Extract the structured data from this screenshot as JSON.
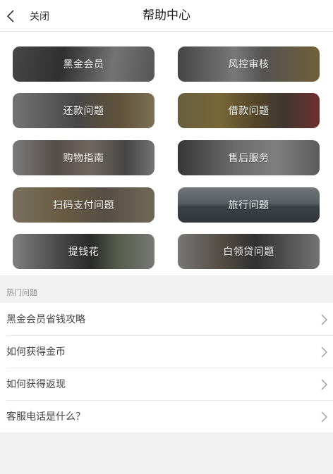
{
  "header": {
    "back_label": "关闭",
    "title": "帮助中心"
  },
  "categories": [
    {
      "label": "黑金会员"
    },
    {
      "label": "风控审核"
    },
    {
      "label": "还款问题"
    },
    {
      "label": "借款问题"
    },
    {
      "label": "购物指南"
    },
    {
      "label": "售后服务"
    },
    {
      "label": "扫码支付问题"
    },
    {
      "label": "旅行问题"
    },
    {
      "label": "提钱花"
    },
    {
      "label": "白领贷问题"
    }
  ],
  "hot": {
    "heading": "热门问题",
    "items": [
      {
        "label": "黑金会员省钱攻略"
      },
      {
        "label": "如何获得金币"
      },
      {
        "label": "如何获得返现"
      },
      {
        "label": "客服电话是什么？"
      }
    ]
  },
  "icons": {
    "back": "chevron-left-icon",
    "row_arrow": "chevron-right-icon"
  },
  "colors": {
    "page_background": "#f2f2f2",
    "tile_text": "#ffffff"
  }
}
